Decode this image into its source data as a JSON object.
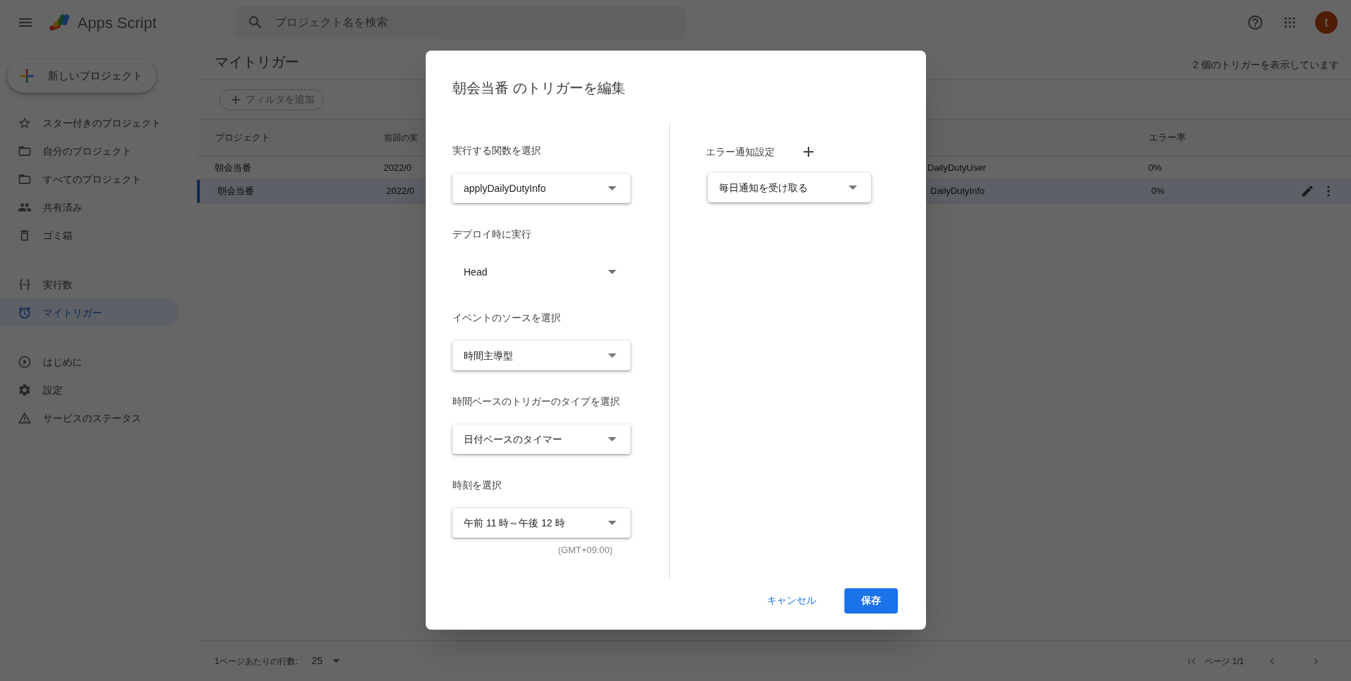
{
  "header": {
    "app_name": "Apps Script",
    "search": {
      "placeholder": "プロジェクト名を検索"
    },
    "avatar": "t"
  },
  "new_project_button": "新しいプロジェクト",
  "sidebar": {
    "groups": [
      [
        {
          "label": "スター付きのプロジェクト",
          "selected": false
        },
        {
          "label": "自分のプロジェクト",
          "selected": false
        },
        {
          "label": "すべてのプロジェクト",
          "selected": false
        },
        {
          "label": "共有済み",
          "selected": false
        },
        {
          "label": "ゴミ箱",
          "selected": false
        }
      ],
      [
        {
          "label": "実行数",
          "selected": false
        },
        {
          "label": "マイトリガー",
          "selected": true
        }
      ],
      [
        {
          "label": "はじめに",
          "selected": false
        },
        {
          "label": "設定",
          "selected": false
        },
        {
          "label": "サービスのステータス",
          "selected": false
        }
      ]
    ]
  },
  "page": {
    "title": "マイトリガー",
    "count_text": "2 個のトリガーを表示しています",
    "filter_chip": "フィルタを追加"
  },
  "table": {
    "columns": {
      "project": "プロジェクト",
      "column_2": "前回の実",
      "error_rate": "エラー率"
    },
    "rows": [
      {
        "project": "朝会当番",
        "column_2": "2022/0",
        "column_3": "DailyDutyUser",
        "error_rate": "0%",
        "selected": false
      },
      {
        "project": "朝会当番",
        "column_2": "2022/0",
        "column_3": "DailyDutyInfo",
        "error_rate": "0%",
        "selected": true
      }
    ]
  },
  "footer": {
    "rows_per_page_label": "1ページあたりの行数:",
    "rows_per_page": "25",
    "page_text": "ページ 1/1"
  },
  "dialog": {
    "title": "朝会当番 のトリガーを編集",
    "fields": [
      {
        "label": "実行する関数を選択",
        "value": "applyDailyDutyInfo",
        "raised": true
      },
      {
        "label": "デプロイ時に実行",
        "value": "Head",
        "raised": false
      },
      {
        "label": "イベントのソースを選択",
        "value": "時間主導型",
        "raised": true
      },
      {
        "label": "時間ベースのトリガーのタイプを選択",
        "value": "日付ベースのタイマー",
        "raised": true
      },
      {
        "label": "時刻を選択",
        "value": "午前 11 時～午後 12 時",
        "raised": true,
        "note": "(GMT+09:00)"
      }
    ],
    "error_notification": {
      "label": "エラー通知設定",
      "value": "毎日通知を受け取る"
    },
    "cancel_button": "キャンセル",
    "save_button": "保存"
  }
}
